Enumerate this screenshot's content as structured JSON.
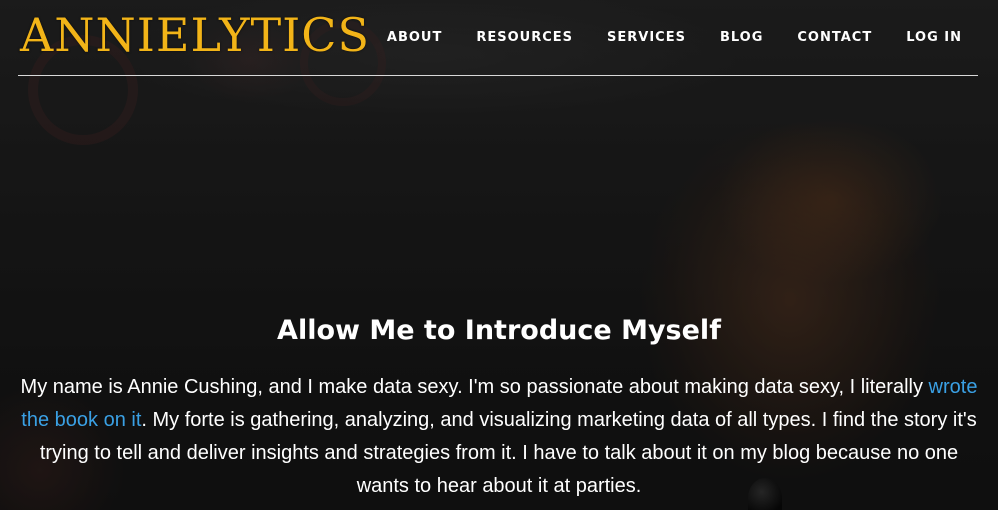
{
  "header": {
    "logo_text": "ANNIELYTICS",
    "nav": [
      {
        "label": "ABOUT"
      },
      {
        "label": "RESOURCES"
      },
      {
        "label": "SERVICES"
      },
      {
        "label": "BLOG"
      },
      {
        "label": "CONTACT"
      },
      {
        "label": "LOG IN"
      }
    ]
  },
  "intro": {
    "title": "Allow Me to Introduce Myself",
    "text_before_link": "My name is Annie Cushing, and I make data sexy. I'm so passionate about making data sexy, I literally ",
    "link_text": "wrote the book on it",
    "text_after_link": ". My forte is gathering, analyzing, and visualizing marketing data of all types. I find the story it's trying to tell and deliver insights and strategies from it. I have to talk about it on my blog because no one wants to hear about it at parties."
  },
  "colors": {
    "logo": "#f2b418",
    "link": "#3aa0e4",
    "text": "#ffffff"
  }
}
